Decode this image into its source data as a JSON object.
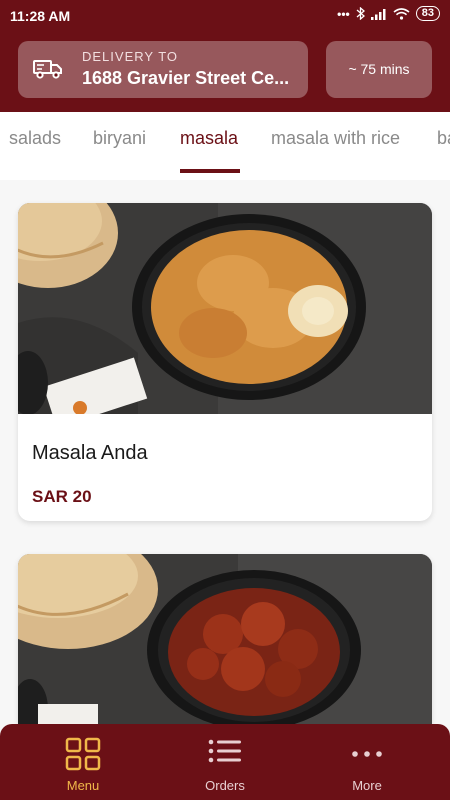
{
  "status_bar": {
    "time": "11:28 AM",
    "battery": "83"
  },
  "delivery": {
    "label": "DELIVERY TO",
    "address": "1688 Gravier Street Ce..."
  },
  "eta": "~ 75 mins",
  "tabs": [
    {
      "label": "salads",
      "active": false
    },
    {
      "label": "biryani",
      "active": false
    },
    {
      "label": "masala",
      "active": true
    },
    {
      "label": "masala with rice",
      "active": false
    },
    {
      "label": "ba",
      "active": false
    }
  ],
  "items": [
    {
      "name": "Masala Anda",
      "price": "SAR 20"
    }
  ],
  "bottom_nav": [
    {
      "label": "Menu",
      "icon": "grid-icon",
      "active": true
    },
    {
      "label": "Orders",
      "icon": "list-icon",
      "active": false
    },
    {
      "label": "More",
      "icon": "more-dots-icon",
      "active": false
    }
  ],
  "colors": {
    "brand": "#6b1016",
    "accent": "#f0b84a"
  }
}
